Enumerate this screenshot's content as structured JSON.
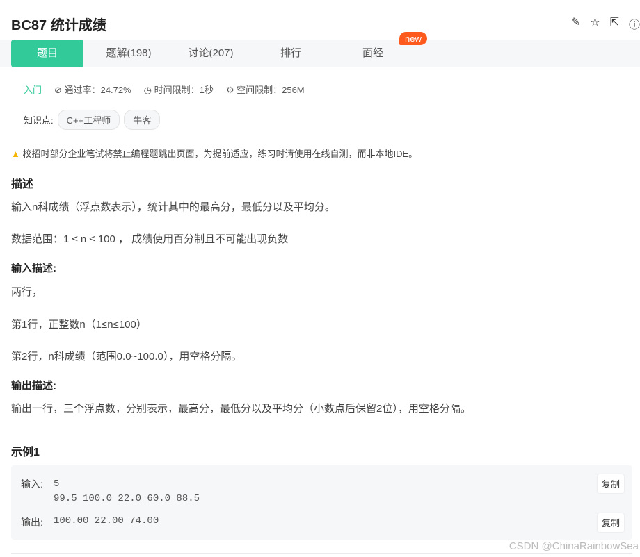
{
  "title": "BC87  统计成绩",
  "tabs": [
    "题目",
    "题解(198)",
    "讨论(207)",
    "排行",
    "面经"
  ],
  "new_badge": "new",
  "meta": {
    "level": "入门",
    "pass_rate": "通过率：24.72%",
    "time_limit": "时间限制：1秒",
    "mem_limit": "空间限制：256M"
  },
  "knowledge": {
    "label": "知识点:",
    "tags": [
      "C++工程师",
      "牛客"
    ]
  },
  "warning": "校招时部分企业笔试将禁止编程题跳出页面，为提前适应，练习时请使用在线自测，而非本地IDE。",
  "desc_h": "描述",
  "desc1": "输入n科成绩（浮点数表示），统计其中的最高分，最低分以及平均分。",
  "desc2": "数据范围：1 ≤ n ≤ 100 ， 成绩使用百分制且不可能出现负数",
  "in_h": "输入描述:",
  "in1": "两行，",
  "in2": "第1行，正整数n（1≤n≤100）",
  "in3": "第2行，n科成绩（范围0.0~100.0），用空格分隔。",
  "out_h": "输出描述:",
  "out1": "输出一行，三个浮点数，分别表示，最高分，最低分以及平均分（小数点后保留2位），用空格分隔。",
  "example": {
    "title": "示例1",
    "in_label": "输入:",
    "in_value": "5\n99.5 100.0 22.0 60.0 88.5",
    "out_label": "输出:",
    "out_value": "100.00 22.00 74.00",
    "copy": "复制"
  },
  "watermark": "CSDN @ChinaRainbowSea"
}
